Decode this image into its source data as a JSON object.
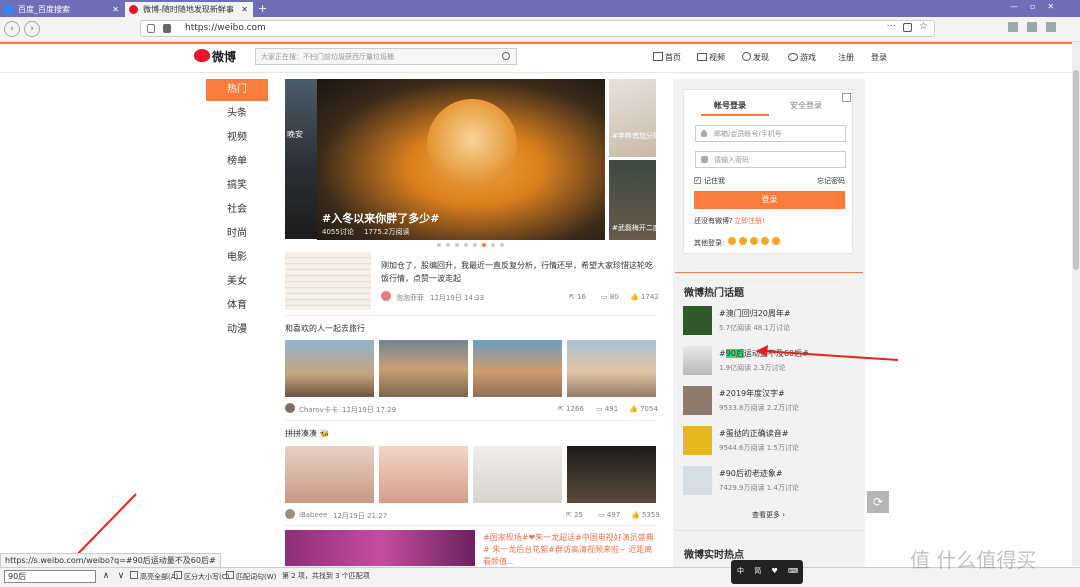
{
  "browser": {
    "tabs": [
      {
        "label": "百度_百度搜索",
        "active": false
      },
      {
        "label": "微博-随时随地发现新鲜事",
        "active": true
      }
    ],
    "url": "https://weibo.com",
    "status_url": "https://s.weibo.com/weibo?q=#90后运动量不及60后#"
  },
  "header": {
    "logo_text": "微博",
    "search_placeholder": "大家正在搜：不扫门前垃圾获西厅量垃圾桶",
    "nav": [
      {
        "label": "首页",
        "icon": "home-icon"
      },
      {
        "label": "视频",
        "icon": "video-icon"
      },
      {
        "label": "发现",
        "icon": "compass-icon"
      },
      {
        "label": "游戏",
        "icon": "game-icon"
      },
      {
        "label": "注册"
      },
      {
        "label": "登录"
      }
    ]
  },
  "left_nav": [
    "热门",
    "头条",
    "视频",
    "榜单",
    "搞笑",
    "社会",
    "时尚",
    "电影",
    "美女",
    "体育",
    "动漫"
  ],
  "hero": {
    "title": "#入冬以来你胖了多少#",
    "discuss": "4055讨论",
    "reads": "1775.2万阅读",
    "side_left_text": "晚安",
    "side_right_top": "#李桦借加分赎",
    "side_right_bottom": "#武磊梅开二度"
  },
  "post1": {
    "text": "刚加仓了，股编回升，我最近一直反复分析，行情还早，希望大家珍惜这轮吃饭行情，点赞一波走起",
    "author": "泡泡菲菲",
    "date": "12月19日 14:33",
    "shares": "16",
    "comments": "80",
    "likes": "1742"
  },
  "post2": {
    "title": "和喜欢的人一起去旅行",
    "author": "Charov卡卡",
    "date": "12月19日 17:29",
    "shares": "1266",
    "comments": "491",
    "likes": "7054"
  },
  "post3": {
    "title": "拼拼凑凑",
    "author": "iBabeee",
    "date": "12月19日 21:27",
    "shares": "25",
    "comments": "497",
    "likes": "5359"
  },
  "post4": {
    "text": "#图家现场#❤朱一龙超话#中国电视好演员盛典# 朱一龙后台花絮#群访高清视频来啦~ 近距离看颜值...",
    "author": "",
    "date": ""
  },
  "login": {
    "tab_account": "帐号登录",
    "tab_secure": "安全登录",
    "email_placeholder": "邮箱/会员帐号/手机号",
    "password_placeholder": "请输入密码",
    "remember": "记住我",
    "forgot": "忘记密码",
    "login_button": "登录",
    "no_account": "还没有微博?",
    "register_now": "立即注册!",
    "other_login": "其他登录:"
  },
  "hot_topics": {
    "title": "微博热门话题",
    "items": [
      {
        "title": "#澳门回归20周年#",
        "stats": "5.7亿阅读 48.1万讨论"
      },
      {
        "title": "#90后运动量不及60后#",
        "stats": "1.9亿阅读 2.3万讨论"
      },
      {
        "title": "#2019年度汉字#",
        "stats": "9533.8万阅读 2.2万讨论"
      },
      {
        "title": "#蛋挞的正确读音#",
        "stats": "9544.6万阅读 1.5万讨论"
      },
      {
        "title": "#90后初老迹象#",
        "stats": "7429.9万阅读 1.4万讨论"
      }
    ],
    "more": "查看更多"
  },
  "realtime": {
    "title": "微博实时热点"
  },
  "findbar": {
    "query": "90后",
    "highlight_all": "高亮全部(A)",
    "match_case": "区分大小写(C)",
    "whole_word": "匹配词句(W)",
    "result": "第 2 项，共找到 3 个匹配项"
  },
  "watermark": "值 什么值得买",
  "colors": {
    "accent": "#fa7d3c",
    "tabbar": "#6f6fb8",
    "link": "#eb7350"
  }
}
